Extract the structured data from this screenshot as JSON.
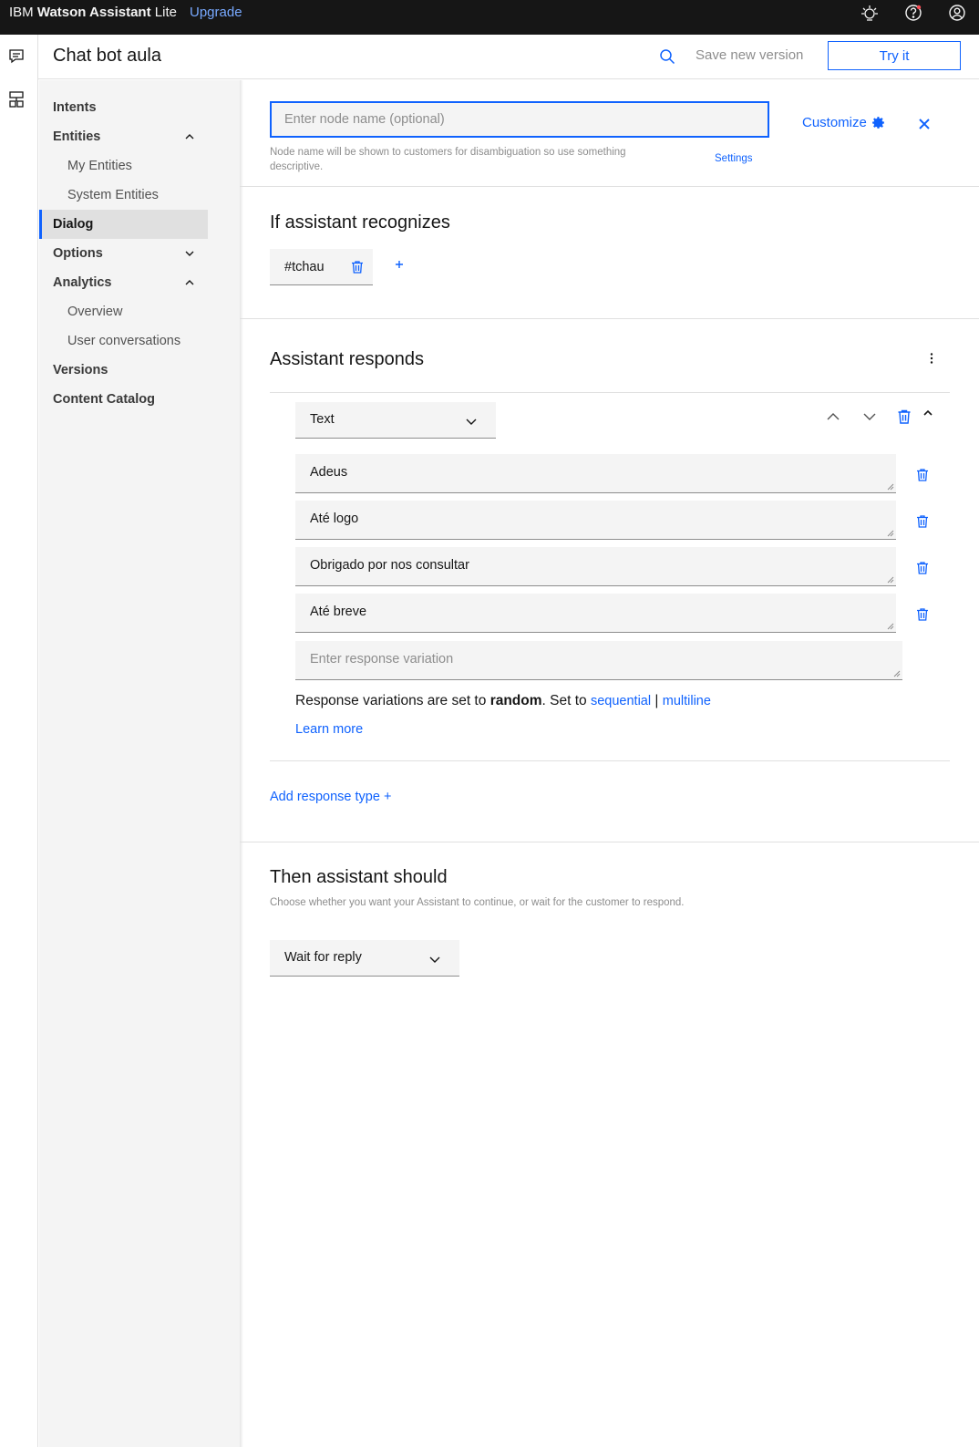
{
  "topbar": {
    "brand_prefix": "IBM",
    "brand_main": "Watson Assistant",
    "brand_suffix": "Lite",
    "upgrade": "Upgrade",
    "icons": [
      "ibm-bulb-icon",
      "help-icon",
      "user-icon"
    ]
  },
  "rail": {
    "icons": [
      "chat-icon",
      "skills-icon"
    ]
  },
  "header": {
    "title": "Chat bot aula",
    "save_version": "Save new version",
    "try_it": "Try it"
  },
  "nav": {
    "items": [
      {
        "label": "Intents"
      },
      {
        "label": "Entities"
      },
      {
        "label": "My Entities"
      },
      {
        "label": "System Entities"
      },
      {
        "label": "Dialog"
      },
      {
        "label": "Options"
      },
      {
        "label": "Analytics"
      },
      {
        "label": "Overview"
      },
      {
        "label": "User conversations"
      },
      {
        "label": "Versions"
      },
      {
        "label": "Content Catalog"
      }
    ]
  },
  "node": {
    "name_placeholder": "Enter node name (optional)",
    "helper": "Node name will be shown to customers for disambiguation so use something descriptive.",
    "settings": "Settings",
    "customize": "Customize"
  },
  "recognizes": {
    "title": "If assistant recognizes",
    "condition": "#tchau"
  },
  "responds": {
    "title": "Assistant responds",
    "type": "Text",
    "variations": [
      "Adeus",
      "Até logo",
      "Obrigado por nos consultar",
      "Até breve"
    ],
    "variation_placeholder": "Enter response variation",
    "mode_prefix": "Response variations are set to",
    "mode_value": "random",
    "mode_mid": ". Set to",
    "sequential": "sequential",
    "separator": "|",
    "multiline": "multiline",
    "learn_more": "Learn more",
    "add_response": "Add response type +"
  },
  "then": {
    "title": "Then assistant should",
    "helper": "Choose whether you want your Assistant to continue, or wait for the customer to respond.",
    "action": "Wait for reply"
  },
  "colors": {
    "accent": "#0f62fe",
    "topbar": "#161616",
    "field": "#f4f4f4"
  }
}
